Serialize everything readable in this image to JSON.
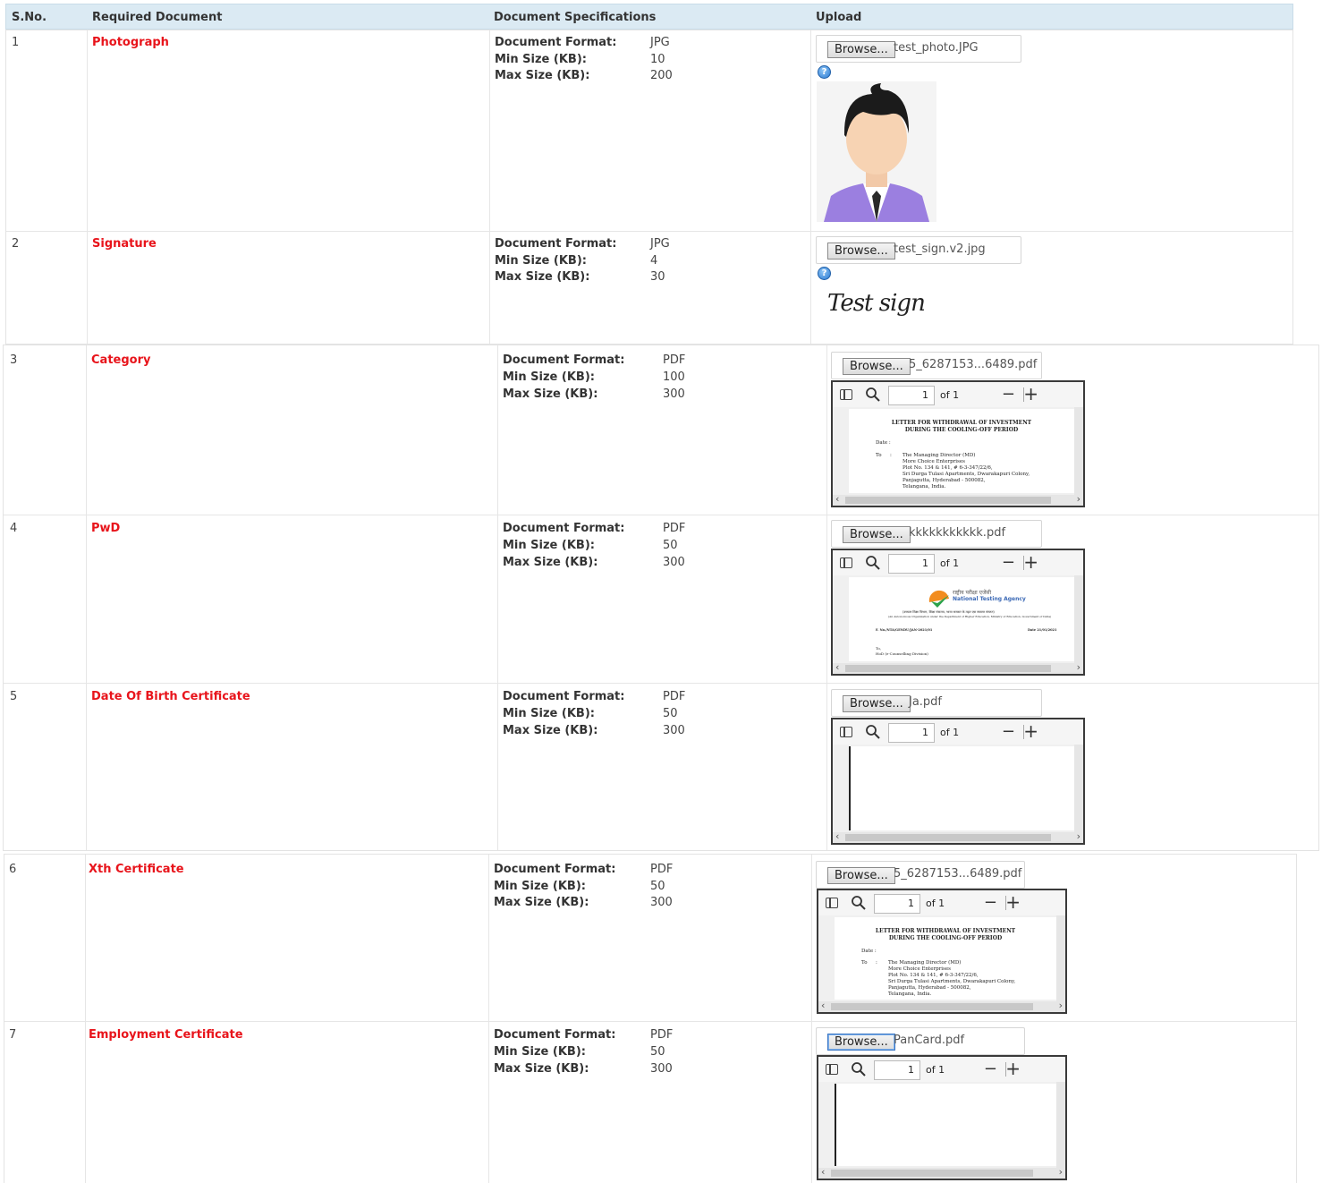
{
  "header": {
    "sno": "S.No.",
    "required_document": "Required Document",
    "document_specifications": "Document Specifications",
    "upload": "Upload"
  },
  "labels": {
    "format": "Document Format:",
    "min": "Min Size (KB):",
    "max": "Max Size (KB):",
    "browse": "Browse...",
    "of_pages": "of 1",
    "page_num": "1"
  },
  "rows": [
    {
      "sno": "1",
      "name": "Photograph",
      "format": "JPG",
      "min": "10",
      "max": "200",
      "file": "test_photo.JPG"
    },
    {
      "sno": "2",
      "name": "Signature",
      "format": "JPG",
      "min": "4",
      "max": "30",
      "file": "test_sign.v2.jpg",
      "sign_text": "Test sign"
    },
    {
      "sno": "3",
      "name": "Category",
      "format": "PDF",
      "min": "100",
      "max": "300",
      "file": "5_6287153...6489.pdf"
    },
    {
      "sno": "4",
      "name": "PwD",
      "format": "PDF",
      "min": "50",
      "max": "300",
      "file": "kkkkkkkkkkk.pdf"
    },
    {
      "sno": "5",
      "name": "Date Of Birth Certificate",
      "format": "PDF",
      "min": "50",
      "max": "300",
      "file": "Ja.pdf"
    },
    {
      "sno": "6",
      "name": "Xth Certificate",
      "format": "PDF",
      "min": "50",
      "max": "300",
      "file": "5_6287153...6489.pdf"
    },
    {
      "sno": "7",
      "name": "Employment Certificate",
      "format": "PDF",
      "min": "50",
      "max": "300",
      "file": "PanCard.pdf"
    }
  ],
  "letter": {
    "title1": "LETTER FOR WITHDRAWAL OF INVESTMENT",
    "title2": "DURING THE COOLING-OFF PERIOD",
    "date": "Date :",
    "to": "To",
    "colon": ":",
    "lines": [
      "The Managing Director (MD)",
      "More Choice Enterprises",
      "Plot No. 134 & 141, # 6-3-347/22/6,",
      "Sri Durga Tulasi Apartments, Dwarakapuri Colony,",
      "Panjagutta, Hyderabad - 500082,",
      "Telangana, India."
    ]
  },
  "nta": {
    "hindi": "राष्ट्रीय परीक्षा एजेंसी",
    "name": "National Testing Agency",
    "sub1": "(उच्चतर शिक्षा विभाग, शिक्षा मंत्रालय, भारत सरकार के तहत एक स्वायत्त संगठन)",
    "sub2": "(An Autonomous Organization under the Department of Higher Education, Ministry of Education, Government of India)",
    "ref": "F. No./NTA/GENDU/JAN-2021/01",
    "date": "Date 21/01/2021",
    "to": "To,",
    "addr": "HoD (e-Counselling Division)"
  }
}
